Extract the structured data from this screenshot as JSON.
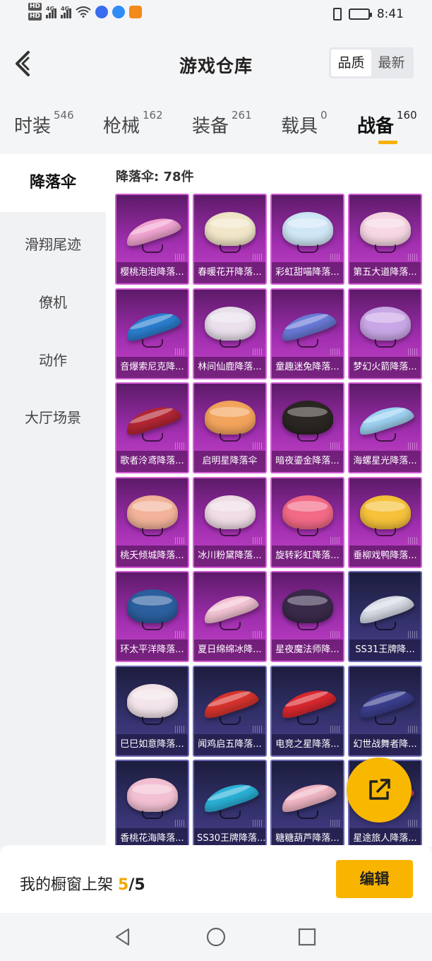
{
  "status": {
    "network": [
      "4G",
      "4G"
    ],
    "hd": [
      "HD",
      "HD"
    ],
    "time": "8:41"
  },
  "header": {
    "title": "游戏仓库",
    "sort": {
      "options": [
        "品质",
        "最新"
      ],
      "selected": "品质"
    }
  },
  "tabs": [
    {
      "label": "时装",
      "count": "546"
    },
    {
      "label": "枪械",
      "count": "162"
    },
    {
      "label": "装备",
      "count": "261"
    },
    {
      "label": "载具",
      "count": "0"
    },
    {
      "label": "战备",
      "count": "160",
      "active": true
    }
  ],
  "sidebar": {
    "items": [
      "降落伞",
      "滑翔尾迹",
      "僚机",
      "动作",
      "大厅场景"
    ],
    "selected": "降落伞"
  },
  "content": {
    "count_label": "降落伞: 78件"
  },
  "items": [
    {
      "name": "樱桃泡泡降落...",
      "style": "purple",
      "color": "#f2a6d2",
      "shape": "wing"
    },
    {
      "name": "春暖花开降落...",
      "style": "purple",
      "color": "#f1e6c8",
      "shape": "dome"
    },
    {
      "name": "彩虹甜喵降落...",
      "style": "purple",
      "color": "#cfe6f6",
      "shape": "dome"
    },
    {
      "name": "第五大道降落...",
      "style": "purple",
      "color": "#f6d7e3",
      "shape": "dome"
    },
    {
      "name": "音爆索尼克降...",
      "style": "purple",
      "color": "#2a7fd0",
      "shape": "wing"
    },
    {
      "name": "林间仙鹿降落...",
      "style": "purple",
      "color": "#e9e0ec",
      "shape": "dome"
    },
    {
      "name": "童趣迷兔降落...",
      "style": "purple",
      "color": "#6a7ad8",
      "shape": "wing"
    },
    {
      "name": "梦幻火箭降落...",
      "style": "purple",
      "color": "#c9a7e6",
      "shape": "dome"
    },
    {
      "name": "歌者泠鸢降落...",
      "style": "purple",
      "color": "#b42634",
      "shape": "wing"
    },
    {
      "name": "启明星降落伞",
      "style": "purple",
      "color": "#f3a45c",
      "shape": "dome"
    },
    {
      "name": "暗夜鎏金降落...",
      "style": "purple",
      "color": "#2a2622",
      "shape": "dome"
    },
    {
      "name": "海螺星光降落...",
      "style": "purple",
      "color": "#9fd3f2",
      "shape": "wing"
    },
    {
      "name": "桃夭倾城降落...",
      "style": "purple",
      "color": "#f3b39a",
      "shape": "dome"
    },
    {
      "name": "冰川粉黛降落...",
      "style": "purple",
      "color": "#f0dde6",
      "shape": "dome"
    },
    {
      "name": "旋转彩虹降落...",
      "style": "purple",
      "color": "#f26a86",
      "shape": "dome"
    },
    {
      "name": "垂柳戏鸭降落...",
      "style": "purple",
      "color": "#f6c23a",
      "shape": "dome"
    },
    {
      "name": "环太平洋降落...",
      "style": "purple",
      "color": "#2b5f9e",
      "shape": "dome"
    },
    {
      "name": "夏日绵绵冰降...",
      "style": "purple",
      "color": "#f4c4d4",
      "shape": "wing"
    },
    {
      "name": "星夜魔法师降...",
      "style": "purple",
      "color": "#3a2a4a",
      "shape": "dome"
    },
    {
      "name": "SS31王牌降...",
      "style": "navy",
      "color": "#d8dce6",
      "shape": "wing"
    },
    {
      "name": "巳巳如意降落...",
      "style": "navy",
      "color": "#f2e4ea",
      "shape": "dome"
    },
    {
      "name": "闻鸡启五降落...",
      "style": "navy",
      "color": "#d8342e",
      "shape": "wing"
    },
    {
      "name": "电竞之星降落...",
      "style": "navy",
      "color": "#d9282f",
      "shape": "wing"
    },
    {
      "name": "幻世战舞者降...",
      "style": "navy",
      "color": "#3b3f8e",
      "shape": "wing"
    },
    {
      "name": "香桃花海降落...",
      "style": "navy",
      "color": "#f3c0d3",
      "shape": "dome"
    },
    {
      "name": "SS30王牌降落...",
      "style": "navy",
      "color": "#2ab2d8",
      "shape": "wing"
    },
    {
      "name": "糖糖葫芦降落...",
      "style": "navy",
      "color": "#f1b7c4",
      "shape": "wing"
    },
    {
      "name": "星途旅人降落...",
      "style": "navy",
      "color": "#e94a5a",
      "shape": "wing"
    }
  ],
  "bottom": {
    "shelf_label": "我的橱窗上架",
    "shelf_current": "5",
    "shelf_sep": "/",
    "shelf_total": "5",
    "edit_label": "编辑"
  },
  "colors": {
    "accent": "#f9b400",
    "purple_card": "#a12fb0",
    "navy_card": "#33316b"
  }
}
